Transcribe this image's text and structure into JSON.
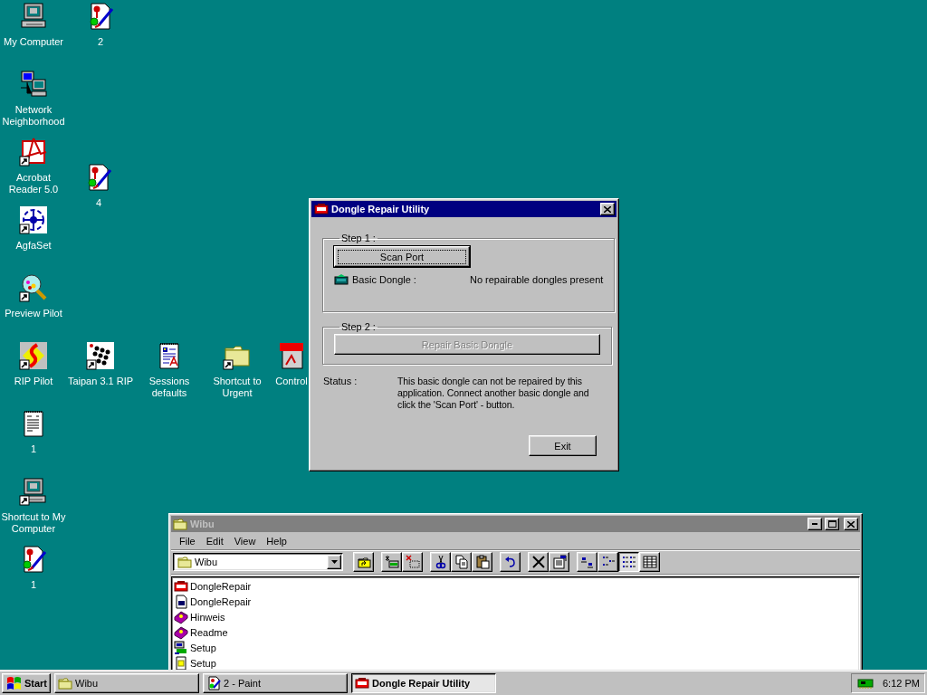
{
  "desktop": {
    "icons": [
      {
        "label": "My Computer",
        "kind": "computer",
        "shortcut": false
      },
      {
        "label": "2",
        "kind": "paint",
        "shortcut": false
      },
      {
        "label": "Network Neighborhood",
        "kind": "network",
        "shortcut": false
      },
      {
        "label": "Acrobat Reader 5.0",
        "kind": "acrobat",
        "shortcut": true
      },
      {
        "label": "4",
        "kind": "paint",
        "shortcut": false
      },
      {
        "label": "AgfaSet",
        "kind": "agfa",
        "shortcut": true
      },
      {
        "label": "Preview Pilot",
        "kind": "preview",
        "shortcut": true
      },
      {
        "label": "RIP Pilot",
        "kind": "rip",
        "shortcut": true
      },
      {
        "label": "Taipan 3.1 RIP",
        "kind": "taipan",
        "shortcut": true
      },
      {
        "label": "Sessions defaults",
        "kind": "sessions",
        "shortcut": false
      },
      {
        "label": "Shortcut to Urgent",
        "kind": "folder",
        "shortcut": true
      },
      {
        "label": "Control",
        "kind": "pdf",
        "shortcut": false
      },
      {
        "label": "1",
        "kind": "notepad",
        "shortcut": false
      },
      {
        "label": "Shortcut to My Computer",
        "kind": "computer",
        "shortcut": true
      },
      {
        "label": "1",
        "kind": "paint",
        "shortcut": false
      }
    ]
  },
  "dialog": {
    "title": "Dongle Repair Utility",
    "active": true,
    "step1": {
      "legend": "Step 1 :",
      "scan_button": "Scan Port",
      "dongle_label": "Basic Dongle :",
      "dongle_status": "No repairable dongles present"
    },
    "step2": {
      "legend": "Step 2 :",
      "repair_button": {
        "label": "Repair Basic Dongle",
        "disabled": true
      }
    },
    "status_label": "Status :",
    "status_text": "This basic dongle can not be repaired by this application. Connect another basic dongle and click the 'Scan Port' - button.",
    "exit_button": "Exit"
  },
  "explorer": {
    "title": "Wibu",
    "active": false,
    "menu": [
      "File",
      "Edit",
      "View",
      "Help"
    ],
    "address": "Wibu",
    "toolbar": [
      {
        "kind": "up",
        "selected": false
      },
      {
        "kind": "map",
        "selected": false
      },
      {
        "kind": "disconnect",
        "selected": false
      },
      {
        "kind": "cut",
        "selected": false
      },
      {
        "kind": "copy",
        "selected": false
      },
      {
        "kind": "paste",
        "selected": false
      },
      {
        "kind": "undo",
        "selected": false
      },
      {
        "kind": "delete",
        "selected": false
      },
      {
        "kind": "properties",
        "selected": false
      },
      {
        "kind": "large",
        "selected": false
      },
      {
        "kind": "small",
        "selected": false
      },
      {
        "kind": "list",
        "selected": true
      },
      {
        "kind": "details",
        "selected": false
      }
    ],
    "files": [
      {
        "name": "DongleRepair",
        "kind": "dongle"
      },
      {
        "name": "DongleRepair",
        "kind": "exe"
      },
      {
        "name": "Hinweis",
        "kind": "book"
      },
      {
        "name": "Readme",
        "kind": "book"
      },
      {
        "name": "Setup",
        "kind": "setup"
      },
      {
        "name": "Setup",
        "kind": "notes"
      }
    ]
  },
  "taskbar": {
    "start": "Start",
    "tasks": [
      {
        "label": "Wibu",
        "kind": "folder",
        "selected": false
      },
      {
        "label": "2 - Paint",
        "kind": "paint",
        "selected": false
      },
      {
        "label": "Dongle Repair Utility",
        "kind": "dongle",
        "selected": true
      }
    ],
    "time": "6:12 PM"
  }
}
